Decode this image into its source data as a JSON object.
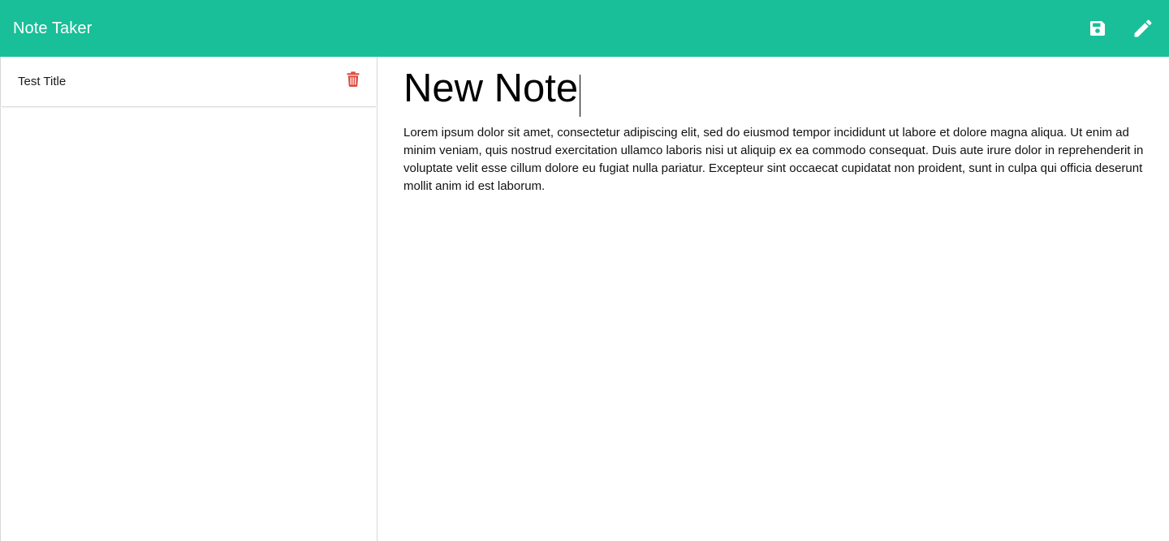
{
  "app": {
    "title": "Note Taker"
  },
  "toolbar": {
    "save_icon": "save-icon",
    "new_note_icon": "pencil-icon"
  },
  "sidebar": {
    "notes": [
      {
        "title": "Test Title",
        "delete_icon": "trash-icon"
      }
    ]
  },
  "editor": {
    "title_value": "New Note",
    "body": "Lorem ipsum dolor sit amet, consectetur adipiscing elit, sed do eiusmod tempor incididunt ut labore et dolore magna aliqua. Ut enim ad minim veniam, quis nostrud exercitation ullamco laboris nisi ut aliquip ex ea commodo consequat. Duis aute irure dolor in reprehenderit in voluptate velit esse cillum dolore eu fugiat nulla pariatur. Excepteur sint occaecat cupidatat non proident, sunt in culpa qui officia deserunt mollit anim id est laborum."
  },
  "colors": {
    "navbar": "#19bf99",
    "delete": "#e04b3f"
  }
}
